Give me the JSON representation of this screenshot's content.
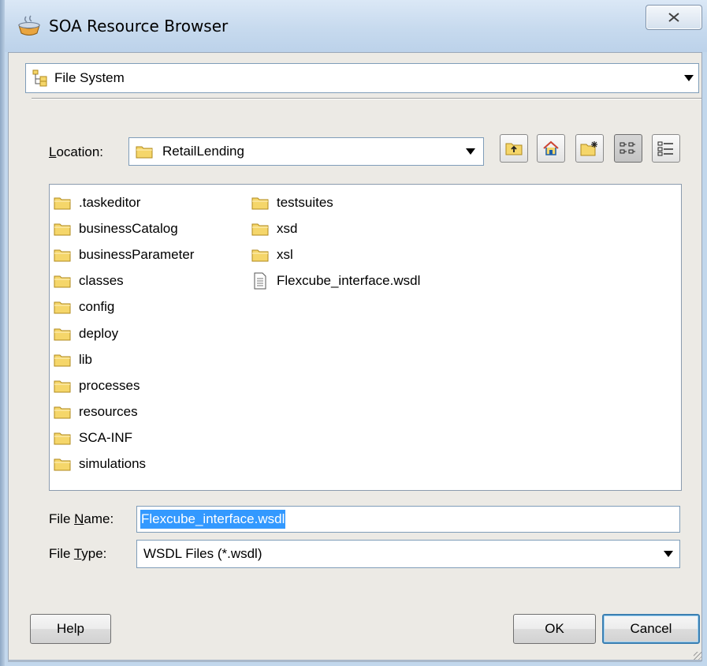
{
  "window": {
    "title": "SOA Resource Browser",
    "close_glyph": "☒"
  },
  "resource_type": {
    "selected": "File System",
    "icon": "file-system-tree-icon"
  },
  "location": {
    "label_prefix": "L",
    "label_rest": "ocation:",
    "selected": "RetailLending",
    "toolbar_icons": [
      "up-folder-icon",
      "home-icon",
      "new-folder-icon",
      "list-view-icon",
      "details-view-icon"
    ],
    "active_view": "list-view"
  },
  "files": {
    "column1": [
      ".taskeditor",
      "businessCatalog",
      "businessParameter",
      "classes",
      "config",
      "deploy",
      "lib",
      "processes",
      "resources",
      "SCA-INF",
      "simulations"
    ],
    "column2_folders": [
      "testsuites",
      "xsd",
      "xsl"
    ],
    "column2_file": "Flexcube_interface.wsdl"
  },
  "file_name": {
    "label_pre": "File ",
    "label_underlined": "N",
    "label_post": "ame:",
    "value": "Flexcube_interface.wsdl"
  },
  "file_type": {
    "label_pre": "File ",
    "label_underlined": "T",
    "label_post": "ype:",
    "selected": "WSDL Files (*.wsdl)"
  },
  "buttons": {
    "help": "Help",
    "ok": "OK",
    "cancel": "Cancel"
  },
  "colors": {
    "folder_fill": "#f5d66a",
    "folder_stroke": "#b08a1e",
    "selection": "#3399ff",
    "default_button_border": "#3c7fb1"
  }
}
